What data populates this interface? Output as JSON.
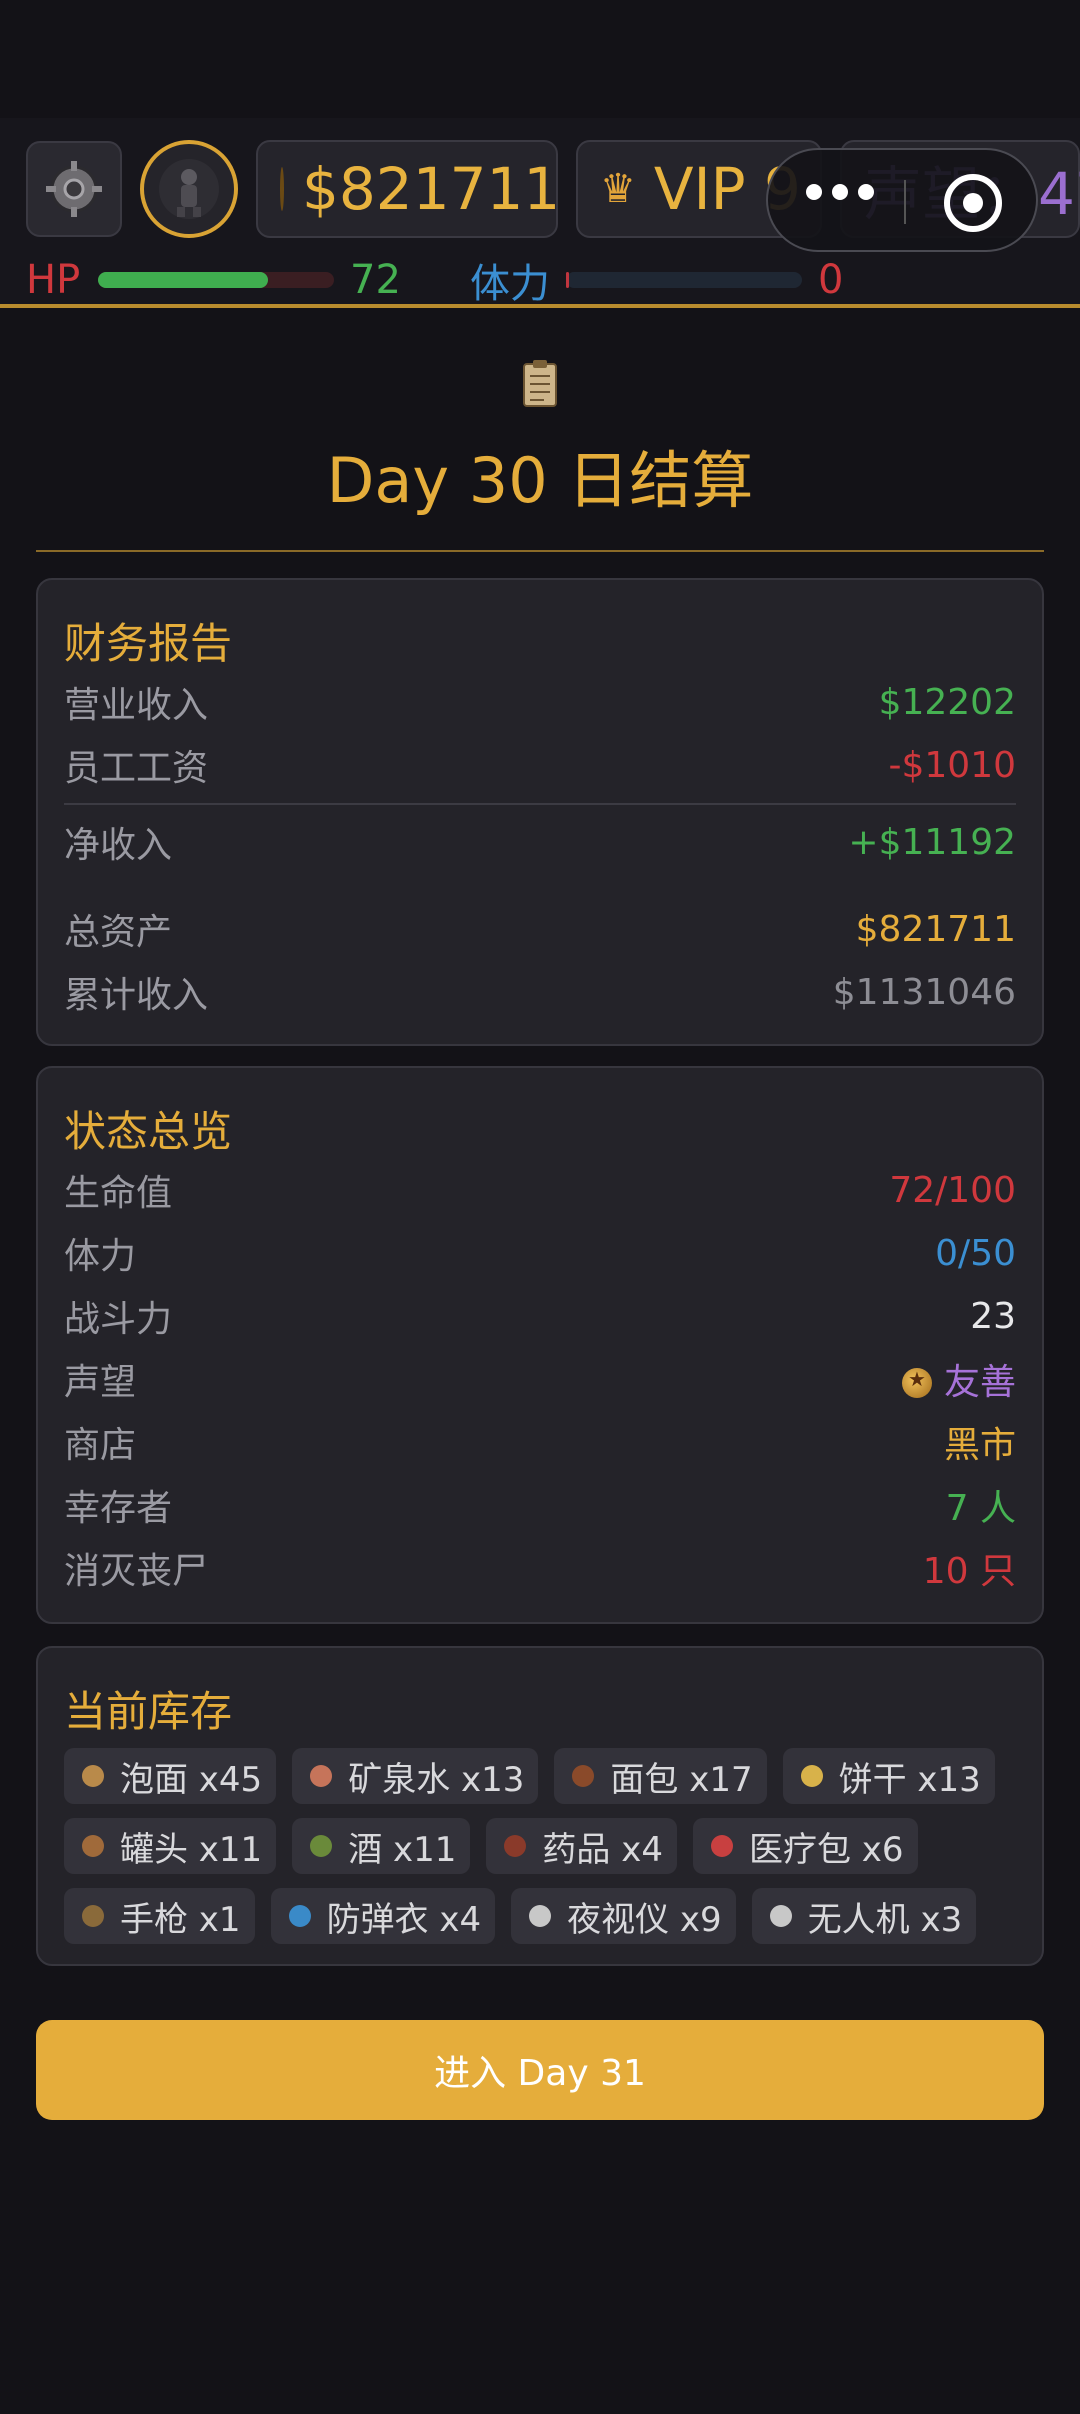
{
  "header": {
    "money": "$821711",
    "vip": "VIP 9",
    "reputation_label": "声望：47",
    "hp_label": "HP",
    "hp_value": "72",
    "hp_fraction": 0.72,
    "stamina_label": "体力",
    "stamina_value": "0",
    "stamina_fraction": 0.0
  },
  "title": "Day 30 日结算",
  "finance": {
    "heading": "财务报告",
    "rows": [
      {
        "label": "营业收入",
        "value": "$12202"
      },
      {
        "label": "员工工资",
        "value": "-$1010"
      },
      {
        "label": "净收入",
        "value": "+$11192"
      },
      {
        "label": "总资产",
        "value": "$821711"
      },
      {
        "label": "累计收入",
        "value": "$1131046"
      }
    ]
  },
  "status": {
    "heading": "状态总览",
    "rows": [
      {
        "label": "生命值",
        "value": "72/100"
      },
      {
        "label": "体力",
        "value": "0/50"
      },
      {
        "label": "战斗力",
        "value": "23"
      },
      {
        "label": "声望",
        "value": "友善"
      },
      {
        "label": "商店",
        "value": "黑市"
      },
      {
        "label": "幸存者",
        "value": "7 人"
      },
      {
        "label": "消灭丧尸",
        "value": "10 只"
      }
    ]
  },
  "inventory": {
    "heading": "当前库存",
    "items": [
      {
        "label": "泡面 x45",
        "icon": "noodle-icon",
        "color": "#b98a4a"
      },
      {
        "label": "矿泉水 x13",
        "icon": "water-icon",
        "color": "#c6745a"
      },
      {
        "label": "面包 x17",
        "icon": "bread-icon",
        "color": "#8a4a2a"
      },
      {
        "label": "饼干 x13",
        "icon": "biscuit-icon",
        "color": "#d8b24a"
      },
      {
        "label": "罐头 x11",
        "icon": "can-icon",
        "color": "#a06a3a"
      },
      {
        "label": "酒 x11",
        "icon": "wine-icon",
        "color": "#6a8a3a"
      },
      {
        "label": "药品 x4",
        "icon": "medicine-icon",
        "color": "#8a3a2a"
      },
      {
        "label": "医疗包 x6",
        "icon": "medkit-icon",
        "color": "#c84040"
      },
      {
        "label": "手枪 x1",
        "icon": "pistol-icon",
        "color": "#8a6a3a"
      },
      {
        "label": "防弹衣 x4",
        "icon": "armor-icon",
        "color": "#3a8ac8"
      },
      {
        "label": "夜视仪 x9",
        "icon": "nightvision-icon",
        "color": "#c8c8c8"
      },
      {
        "label": "无人机 x3",
        "icon": "drone-icon",
        "color": "#c8c8c8"
      }
    ]
  },
  "cta_label": "进入 Day 31"
}
